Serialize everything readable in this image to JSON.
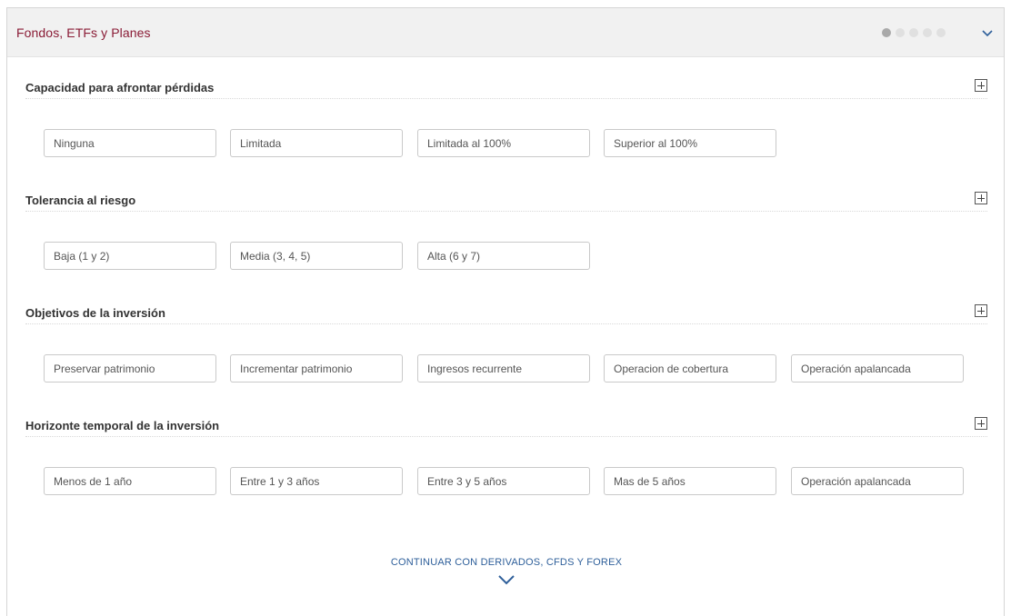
{
  "panel": {
    "title": "Fondos, ETFs y Planes",
    "pager": {
      "total": 5,
      "active": 1
    },
    "collapse_icon": "chevron-down-icon",
    "accent_color": "#8a1c36",
    "link_color": "#2e5f9a"
  },
  "sections": [
    {
      "title": "Capacidad para afrontar pérdidas",
      "options": [
        "Ninguna",
        "Limitada",
        "Limitada al 100%",
        "Superior al 100%"
      ]
    },
    {
      "title": "Tolerancia al riesgo",
      "options": [
        "Baja (1 y 2)",
        "Media (3, 4, 5)",
        "Alta (6 y 7)"
      ]
    },
    {
      "title": "Objetivos de la inversión",
      "options": [
        "Preservar patrimonio",
        "Incrementar patrimonio",
        "Ingresos recurrente",
        "Operacion de cobertura",
        "Operación apalancada"
      ]
    },
    {
      "title": "Horizonte temporal de la inversión",
      "options": [
        "Menos de 1 año",
        "Entre 1 y 3 años",
        "Entre 3 y 5 años",
        "Mas de 5 años",
        "Operación apalancada"
      ]
    }
  ],
  "continue": {
    "label": "CONTINUAR CON DERIVADOS, CFDS Y FOREX",
    "icon": "chevron-down-icon"
  }
}
